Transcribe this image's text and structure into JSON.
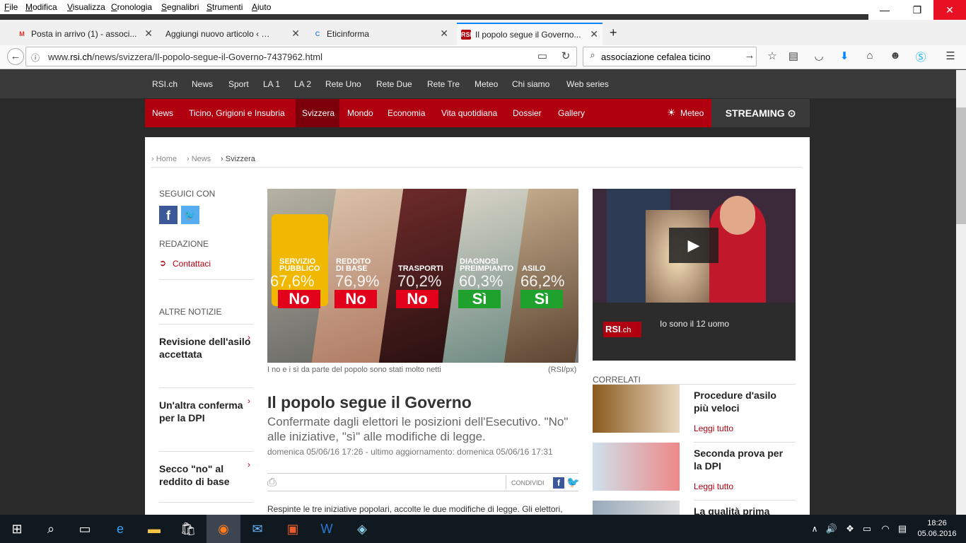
{
  "menu": [
    "File",
    "Modifica",
    "Visualizza",
    "Cronologia",
    "Segnalibri",
    "Strumenti",
    "Aiuto"
  ],
  "window_controls": {
    "minimize": "—",
    "restore": "❐",
    "close": "✕"
  },
  "tabs": [
    {
      "label": "Posta in arrivo (1) - associ...",
      "icon": "gmail-icon"
    },
    {
      "label": "Aggiungi nuovo articolo ‹ Etici...",
      "icon": "wordpress-icon"
    },
    {
      "label": "Eticinforma",
      "icon": "eticinforma-icon"
    },
    {
      "label": "Il popolo segue il Governo...",
      "icon": "rsi-icon"
    }
  ],
  "new_tab": "+",
  "address": {
    "prefix": "www.",
    "host": "rsi.ch",
    "path": "/news/svizzera/Il-popolo-segue-il-Governo-7437962.html"
  },
  "search": {
    "value": "associazione cefalea ticino"
  },
  "topnav": [
    "RSI.ch",
    "News",
    "Sport",
    "LA 1",
    "LA 2",
    "Rete Uno",
    "Rete Due",
    "Rete Tre",
    "Meteo",
    "Chi siamo",
    "Web series"
  ],
  "rednav": [
    "News",
    "Ticino, Grigioni e Insubria",
    "Svizzera",
    "Mondo",
    "Economia",
    "Vita quotidiana",
    "Dossier",
    "Gallery"
  ],
  "meteo": "Meteo",
  "streaming": "STREAMING",
  "breadcrumb": [
    "Home",
    "News",
    "Svizzera"
  ],
  "sidebar": {
    "seguici": "SEGUICI CON",
    "redazione": "REDAZIONE",
    "contattaci": "Contattaci",
    "altre": "ALTRE NOTIZIE",
    "items": [
      "Revisione dell'asilo accettata",
      "Un'altra conferma per la DPI",
      "Secco \"no\" al reddito di base"
    ]
  },
  "hero": {
    "panels": [
      {
        "title": "SERVIZIO PUBBLICO",
        "pct": "67,6%",
        "vote": "No"
      },
      {
        "title": "REDDITO DI BASE",
        "pct": "76,9%",
        "vote": "No"
      },
      {
        "title": "TRASPORTI",
        "pct": "70,2%",
        "vote": "No"
      },
      {
        "title": "DIAGNOSI PREIMPIANTO",
        "pct": "60,3%",
        "vote": "Sì"
      },
      {
        "title": "ASILO",
        "pct": "66,2%",
        "vote": "Sì"
      }
    ],
    "caption": "I no e i sì da parte del popolo sono stati molto netti",
    "credit": "(RSI/px)"
  },
  "article": {
    "title": "Il popolo segue il Governo",
    "subtitle": "Confermate dagli elettori le posizioni dell'Esecutivo. \"No\" alle iniziative, \"sì\" alle modifiche di legge.",
    "date": "domenica 05/06/16 17:26 - ultimo aggiornamento: domenica 05/06/16 17:31",
    "condividi": "CONDIVIDI",
    "body": "Respinte le tre iniziative popolari, accolte le due modifiche di legge. Gli elettori,"
  },
  "video": {
    "caption": "Io sono il 12 uomo",
    "logo": "RSI",
    "logo_suffix": ".ch"
  },
  "correlati": {
    "heading": "CORRELATI",
    "items": [
      {
        "title": "Procedure d'asilo più veloci",
        "link": "Leggi tutto"
      },
      {
        "title": "Seconda prova per la DPI",
        "link": "Leggi tutto"
      },
      {
        "title": "La qualità prima",
        "link": ""
      }
    ]
  },
  "clock": {
    "time": "18:26",
    "date": "05.06.2016"
  },
  "colors": {
    "accent": "#b0000f",
    "dark": "#3a3a3a",
    "no": "#e3001b",
    "si": "#1fa12e"
  }
}
